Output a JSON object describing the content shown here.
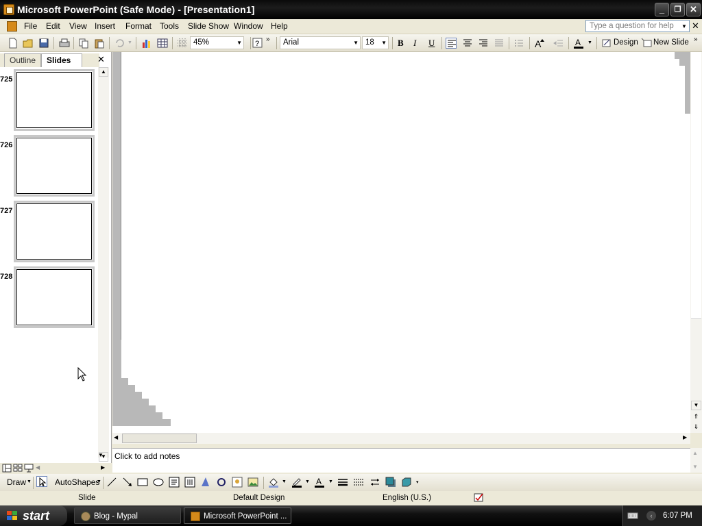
{
  "window": {
    "title": "Microsoft PowerPoint (Safe Mode) - [Presentation1]"
  },
  "menu": [
    "File",
    "Edit",
    "View",
    "Insert",
    "Format",
    "Tools",
    "Slide Show",
    "Window",
    "Help"
  ],
  "help": {
    "placeholder": "Type a question for help"
  },
  "toolbar": {
    "zoom": "45%",
    "font": "Arial",
    "size": "18",
    "bold": "B",
    "italic": "I",
    "underline": "U",
    "design": "Design",
    "new_slide": "New Slide"
  },
  "pane": {
    "tab_outline": "Outline",
    "tab_slides": "Slides",
    "close": "✕"
  },
  "slides": [
    {
      "num": "725"
    },
    {
      "num": "726"
    },
    {
      "num": "727"
    },
    {
      "num": "728"
    }
  ],
  "notes": {
    "placeholder": "Click to add notes"
  },
  "draw": {
    "draw_label": "Draw",
    "autoshapes": "AutoShapes"
  },
  "status": {
    "view": "Slide",
    "design": "Default Design",
    "language": "English (U.S.)"
  },
  "taskbar": {
    "start": "start",
    "tasks": [
      "Blog - Mypal",
      "Microsoft PowerPoint ..."
    ],
    "time": "6:07 PM"
  }
}
